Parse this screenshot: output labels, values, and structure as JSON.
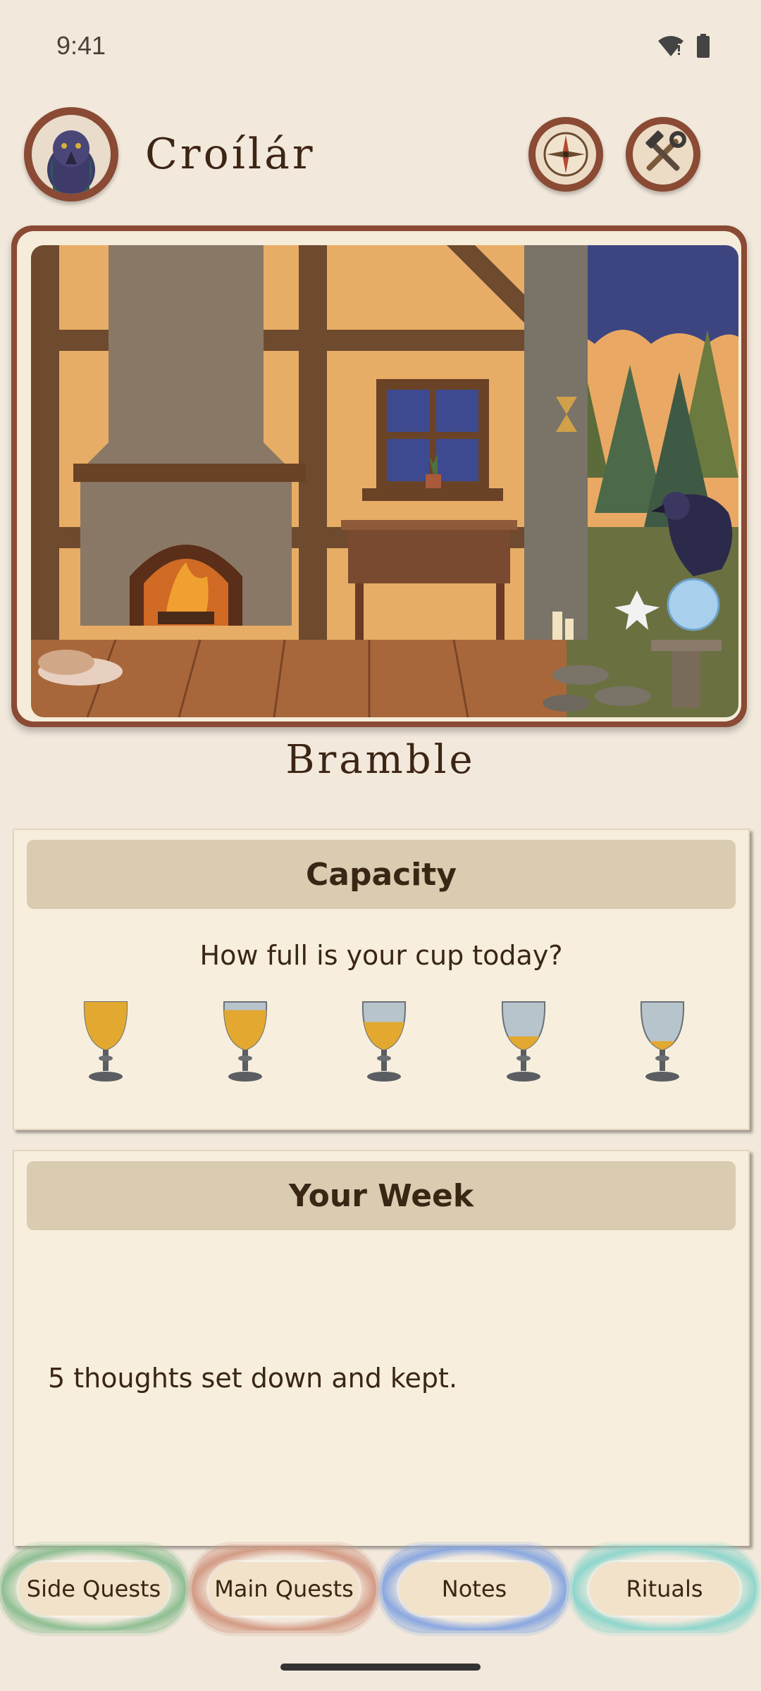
{
  "status_bar": {
    "time": "9:41",
    "icons": [
      "wifi-icon",
      "battery-icon"
    ]
  },
  "header": {
    "title": "Croílár",
    "avatar_icon": "raven-avatar-icon",
    "buttons": [
      {
        "name": "compass-button",
        "icon": "compass-icon"
      },
      {
        "name": "tools-button",
        "icon": "hammer-wrench-icon"
      }
    ]
  },
  "scene": {
    "description_icons": [
      "fireplace",
      "window",
      "desk",
      "hourglass",
      "raven",
      "crystal-ball",
      "sleeping-cat",
      "pine-trees"
    ]
  },
  "character_name": "Bramble",
  "capacity": {
    "title": "Capacity",
    "question": "How full is your cup today?",
    "cups": [
      {
        "label": "full",
        "fill": 1.0
      },
      {
        "label": "mostly-full",
        "fill": 0.8
      },
      {
        "label": "half",
        "fill": 0.55
      },
      {
        "label": "low",
        "fill": 0.25
      },
      {
        "label": "nearly-empty",
        "fill": 0.15
      }
    ]
  },
  "week": {
    "title": "Your Week",
    "summary": "5 thoughts set down and kept."
  },
  "nav": {
    "items": [
      {
        "label": "Side Quests",
        "glow": "#8fbf93"
      },
      {
        "label": "Main Quests",
        "glow": "#d39b85"
      },
      {
        "label": "Notes",
        "glow": "#8aa8e0"
      },
      {
        "label": "Rituals",
        "glow": "#8fd6cc"
      }
    ]
  },
  "colors": {
    "background": "#f2e9dc",
    "frame": "#8a4a34",
    "card": "#f7eedd",
    "card_header": "#d9ccb0",
    "text": "#3a2615"
  }
}
